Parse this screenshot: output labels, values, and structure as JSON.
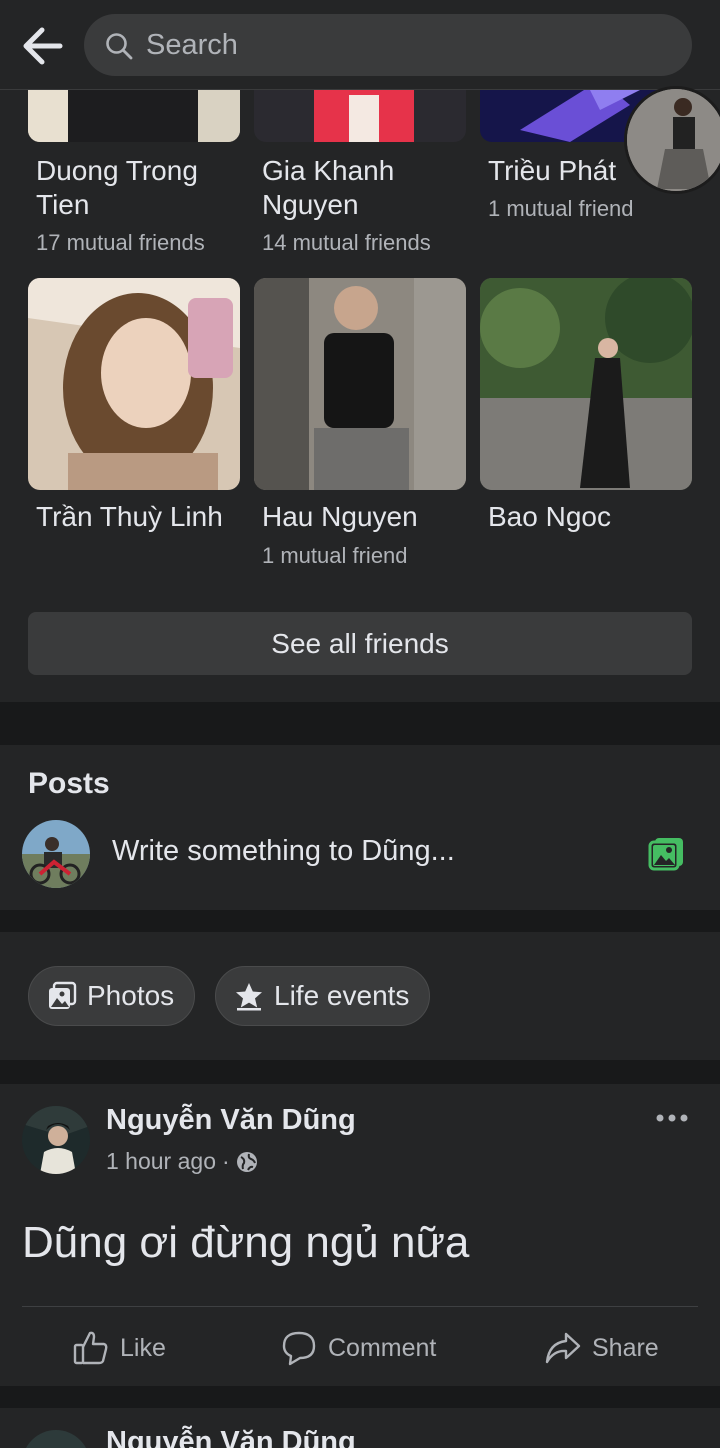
{
  "search": {
    "placeholder": "Search"
  },
  "friends": [
    {
      "name": "Duong Trong Tien",
      "mutual": "17 mutual friends"
    },
    {
      "name": "Gia Khanh Nguyen",
      "mutual": "14 mutual friends"
    },
    {
      "name": "Triều Phát",
      "mutual": "1 mutual friend"
    },
    {
      "name": "Trần Thuỳ Linh",
      "mutual": ""
    },
    {
      "name": "Hau Nguyen",
      "mutual": "1 mutual friend"
    },
    {
      "name": "Bao Ngoc",
      "mutual": ""
    }
  ],
  "see_all_label": "See all friends",
  "posts": {
    "title": "Posts",
    "composer_placeholder": "Write something to Dũng...",
    "chips": [
      {
        "label": "Photos",
        "icon": "photos-icon"
      },
      {
        "label": "Life events",
        "icon": "star-icon"
      }
    ]
  },
  "post": {
    "author": "Nguyễn Văn Dũng",
    "time": "1 hour ago",
    "privacy_icon": "globe-icon",
    "text": "Dũng ơi đừng ngủ nữa",
    "actions": {
      "like": "Like",
      "comment": "Comment",
      "share": "Share"
    }
  },
  "next_post": {
    "author": "Nguyễn Văn Dũng"
  },
  "colors": {
    "background": "#18191a",
    "card": "#242526",
    "button": "#3a3b3c",
    "text_primary": "#e4e6eb",
    "text_secondary": "#b0b3b8",
    "photo_icon_green": "#45bd62"
  }
}
